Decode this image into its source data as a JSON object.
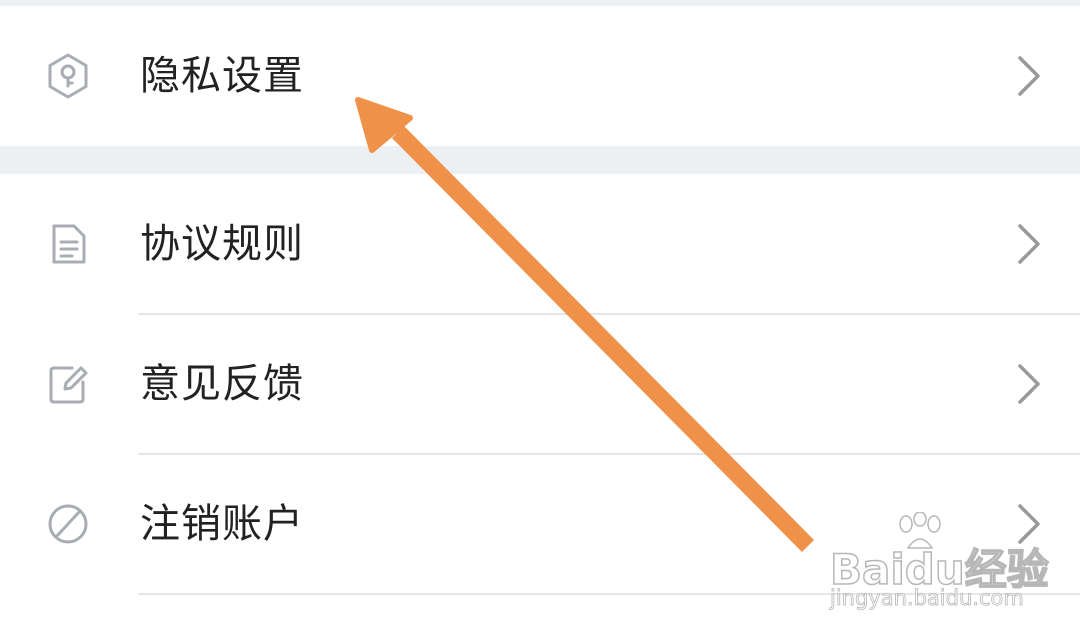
{
  "menu": {
    "items": [
      {
        "label": "隐私设置",
        "icon": "privacy-shield-icon"
      },
      {
        "label": "协议规则",
        "icon": "document-icon"
      },
      {
        "label": "意见反馈",
        "icon": "edit-feedback-icon"
      },
      {
        "label": "注销账户",
        "icon": "cancel-account-icon"
      }
    ],
    "chevron_icon": "chevron-right-icon"
  },
  "annotation": {
    "arrow_color": "#f0914a",
    "points_to": "隐私设置"
  },
  "watermark": {
    "brand": "Baidu经验",
    "url": "jingyan.baidu.com"
  },
  "colors": {
    "separator_band": "#edf0f3",
    "icon_gray": "#a9adb3",
    "chevron_gray": "#9a9a9a",
    "text": "#222222"
  }
}
